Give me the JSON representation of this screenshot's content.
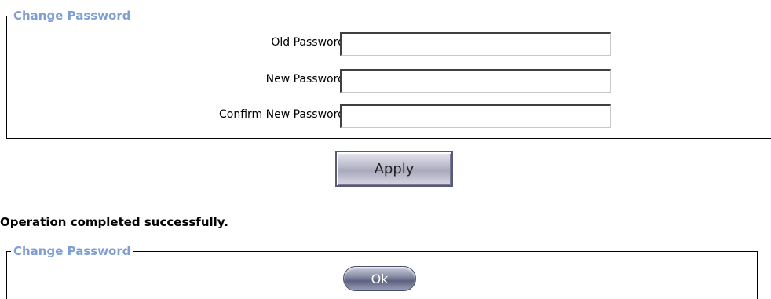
{
  "change_password_form": {
    "legend": "Change Password",
    "fields": [
      {
        "label": "Old Password",
        "value": ""
      },
      {
        "label": "New Password",
        "value": ""
      },
      {
        "label": "Confirm New Password",
        "value": ""
      }
    ],
    "apply_label": "Apply"
  },
  "status": {
    "message": "Operation completed successfully."
  },
  "result_panel": {
    "legend": "Change Password",
    "ok_label": "Ok"
  },
  "colors": {
    "legend_text": "#7f9fd4",
    "border": "#000000",
    "background": "#ffffff"
  }
}
